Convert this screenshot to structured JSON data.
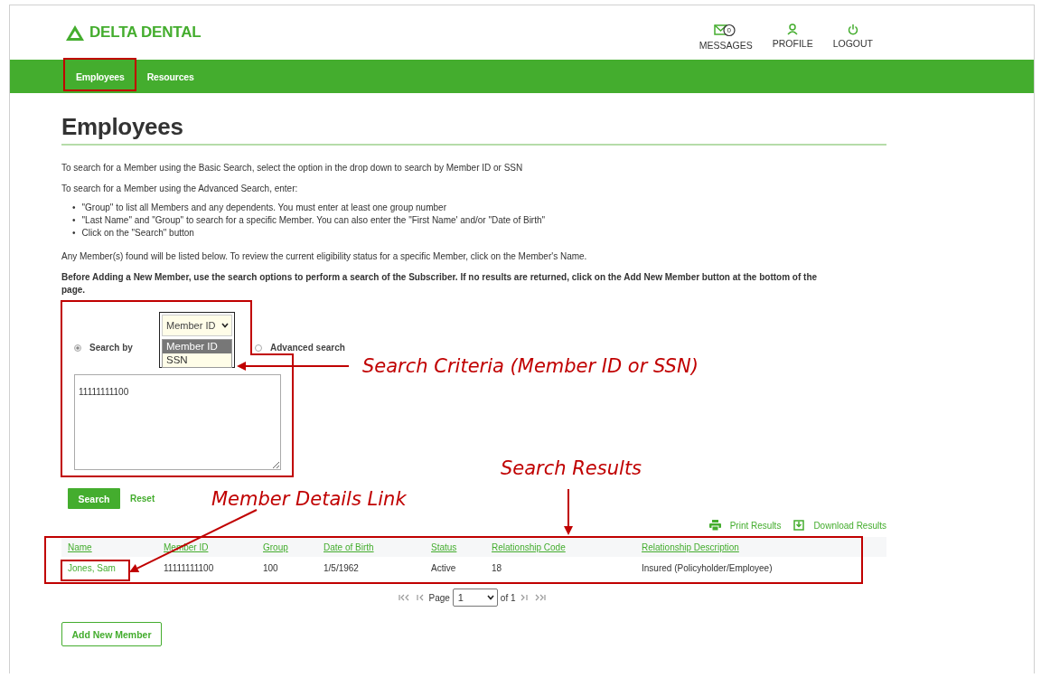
{
  "header": {
    "logo": "DELTA DENTAL",
    "actions": [
      {
        "kind": "messages",
        "label": "MESSAGES",
        "badge": "0"
      },
      {
        "kind": "profile",
        "label": "PROFILE"
      },
      {
        "kind": "logout",
        "label": "LOGOUT"
      }
    ]
  },
  "nav": {
    "items": [
      {
        "label": "Employees"
      },
      {
        "label": "Resources"
      }
    ]
  },
  "page": {
    "title": "Employees",
    "intro": "To search for a Member using the Basic Search, select the option in the drop down to search by Member ID or SSN",
    "advanced_intro": "To search for a Member using the Advanced Search, enter:",
    "bullets": [
      {
        "marker": "•",
        "text": "\"Group\"  to list all Members and any dependents. You must enter at least one group number"
      },
      {
        "marker": "•",
        "text": "\"Last Name\" and \"Group\" to search for a specific Member. You can also enter the \"First Name' and/or \"Date of Birth\""
      },
      {
        "marker": "•",
        "text": "Click on the \"Search\" button"
      }
    ],
    "note": "Any Member(s) found will be listed below. To review the current eligibility status for a specific Member, click on the Member's Name.",
    "warning": "Before Adding a New Member, use the search options to perform a search of the Subscriber. If no results are returned, click on the Add New Member button at the bottom of the page."
  },
  "search": {
    "modes": [
      {
        "label": "Search by",
        "selected": true
      },
      {
        "label": "Advanced search",
        "selected": false
      }
    ],
    "dropdown": {
      "value": "Member ID",
      "expanded": true,
      "options": [
        {
          "label": "Member ID",
          "selected": true
        },
        {
          "label": "SSN",
          "selected": false
        }
      ]
    },
    "value": "11111111100",
    "search_button": "Search",
    "reset_link": "Reset"
  },
  "results": {
    "actions": [
      {
        "kind": "print",
        "label": "Print Results"
      },
      {
        "kind": "download",
        "label": "Download Results"
      }
    ],
    "columns": [
      "Name",
      "Member ID",
      "Group",
      "Date of Birth",
      "Status",
      "Relationship Code",
      "Relationship Description"
    ],
    "rows": [
      {
        "cells": [
          "Jones, Sam",
          "11111111100",
          "100",
          "1/5/1962",
          "Active",
          "18",
          "Insured (Policyholder/Employee)"
        ]
      }
    ]
  },
  "pagination": {
    "label": "Page",
    "page": "1",
    "total": "of 1"
  },
  "add_button": "Add New Member",
  "annotations": [
    {
      "text": "Search Criteria (Member ID or SSN)"
    },
    {
      "text": "Search Results"
    },
    {
      "text": "Member Details Link"
    }
  ]
}
